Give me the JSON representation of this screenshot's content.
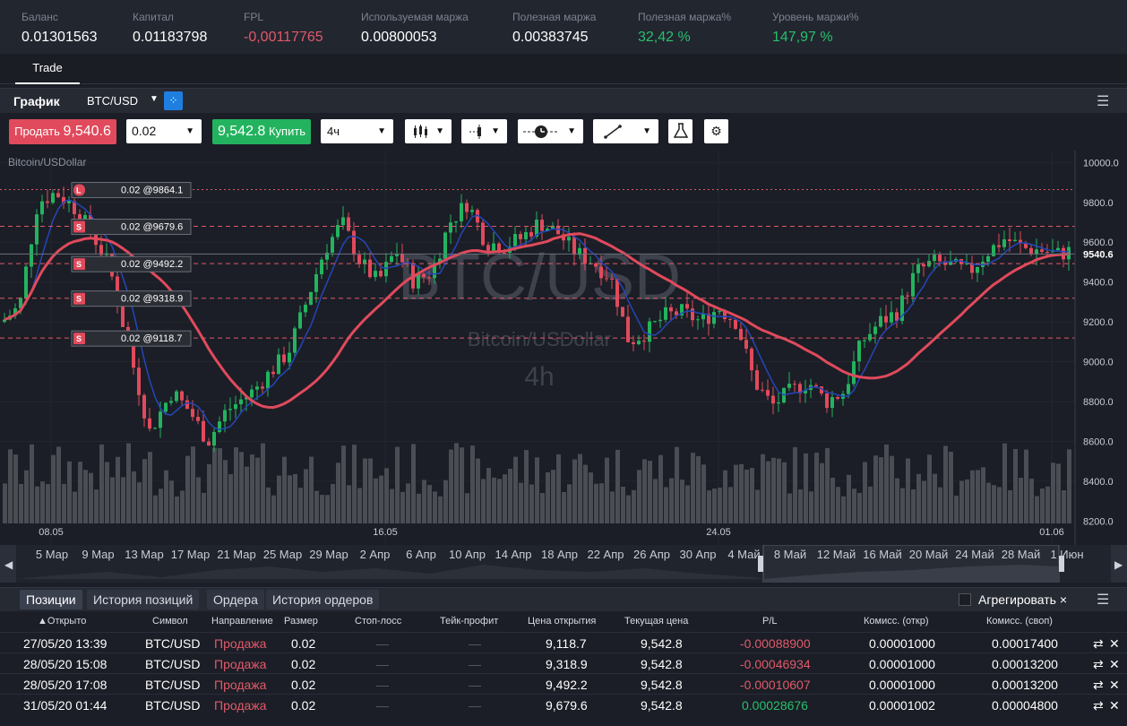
{
  "account": {
    "items": [
      {
        "label": "Баланс",
        "value": "0.01301563",
        "tone": "normal"
      },
      {
        "label": "Капитал",
        "value": "0.01183798",
        "tone": "normal"
      },
      {
        "label": "FPL",
        "value": "-0,00117765",
        "tone": "neg"
      },
      {
        "label": "Используемая маржа",
        "value": "0.00800053",
        "tone": "normal"
      },
      {
        "label": "Полезная маржа",
        "value": "0.00383745",
        "tone": "normal"
      },
      {
        "label": "Полезная маржа%",
        "value": "32,42 %",
        "tone": "pos"
      },
      {
        "label": "Уровень маржи%",
        "value": "147,97 %",
        "tone": "pos"
      }
    ]
  },
  "tabs": {
    "trade": "Trade"
  },
  "chart_header": {
    "title": "График",
    "symbol": "BTC/USD"
  },
  "toolbar": {
    "sell_label": "Продать",
    "sell_price": "9,540.6",
    "quantity": "0.02",
    "buy_price": "9,542.8",
    "buy_label": "Купить",
    "timeframe": "4ч"
  },
  "chart_data": {
    "type": "candlestick",
    "symbol_label": "Bitcoin/USDollar",
    "watermark": {
      "symbol": "BTC/USD",
      "name": "Bitcoin/USDollar",
      "timeframe": "4h"
    },
    "y_ticks": [
      "10000.0",
      "9800.0",
      "9600.0",
      "9400.0",
      "9200.0",
      "9000.0",
      "8800.0",
      "8600.0",
      "8400.0",
      "8200.0"
    ],
    "ylim": [
      8080,
      10060
    ],
    "x_ticks": [
      "08.05",
      "16.05",
      "24.05",
      "01.06"
    ],
    "current_price": "9540.6",
    "orders": [
      {
        "label": "0.02 @9864.1",
        "badge": "L",
        "price": 9864.1
      },
      {
        "label": "0.02 @9679.6",
        "badge": "S",
        "price": 9679.6
      },
      {
        "label": "0.02 @9492.2",
        "badge": "S",
        "price": 9492.2
      },
      {
        "label": "0.02 @9318.9",
        "badge": "S",
        "price": 9318.9
      },
      {
        "label": "0.02 @9118.7",
        "badge": "S",
        "price": 9118.7
      }
    ],
    "colors": {
      "up": "#23b35f",
      "down": "#e04a5c",
      "ma_fast": "#2446b8",
      "ma_slow": "#e04a5c",
      "volume": "#4a4d53"
    }
  },
  "navigator": {
    "dates": [
      "5 Мар",
      "9 Мар",
      "13 Мар",
      "17 Мар",
      "21 Мар",
      "25 Мар",
      "29 Мар",
      "2 Апр",
      "6 Апр",
      "10 Апр",
      "14 Апр",
      "18 Апр",
      "22 Апр",
      "26 Апр",
      "30 Апр",
      "4 Май",
      "8 Май",
      "12 Май",
      "16 Май",
      "20 Май",
      "24 Май",
      "28 Май",
      "1 Июн"
    ]
  },
  "positions": {
    "tabs": [
      "Позиции",
      "История позиций",
      "Ордера",
      "История ордеров"
    ],
    "aggregate_label": "Агрегировать",
    "columns": [
      "▲Открыто",
      "Символ",
      "Направление",
      "Размер",
      "Стоп-лосс",
      "Тейк-профит",
      "Цена открытия",
      "Текущая цена",
      "P/L",
      "Комисс. (откр)",
      "Комисс. (своп)"
    ],
    "rows": [
      {
        "opened": "27/05/20 13:39",
        "symbol": "BTC/USD",
        "direction": "Продажа",
        "size": "0.02",
        "sl": "—",
        "tp": "—",
        "open_price": "9,118.7",
        "current": "9,542.8",
        "pl": "-0.00088900",
        "fee_open": "0.00001000",
        "fee_swap": "0.00017400"
      },
      {
        "opened": "28/05/20 15:08",
        "symbol": "BTC/USD",
        "direction": "Продажа",
        "size": "0.02",
        "sl": "—",
        "tp": "—",
        "open_price": "9,318.9",
        "current": "9,542.8",
        "pl": "-0.00046934",
        "fee_open": "0.00001000",
        "fee_swap": "0.00013200"
      },
      {
        "opened": "28/05/20 17:08",
        "symbol": "BTC/USD",
        "direction": "Продажа",
        "size": "0.02",
        "sl": "—",
        "tp": "—",
        "open_price": "9,492.2",
        "current": "9,542.8",
        "pl": "-0.00010607",
        "fee_open": "0.00001000",
        "fee_swap": "0.00013200"
      },
      {
        "opened": "31/05/20 01:44",
        "symbol": "BTC/USD",
        "direction": "Продажа",
        "size": "0.02",
        "sl": "—",
        "tp": "—",
        "open_price": "9,679.6",
        "current": "9,542.8",
        "pl": "0.00028676",
        "fee_open": "0.00001002",
        "fee_swap": "0.00004800"
      }
    ]
  }
}
